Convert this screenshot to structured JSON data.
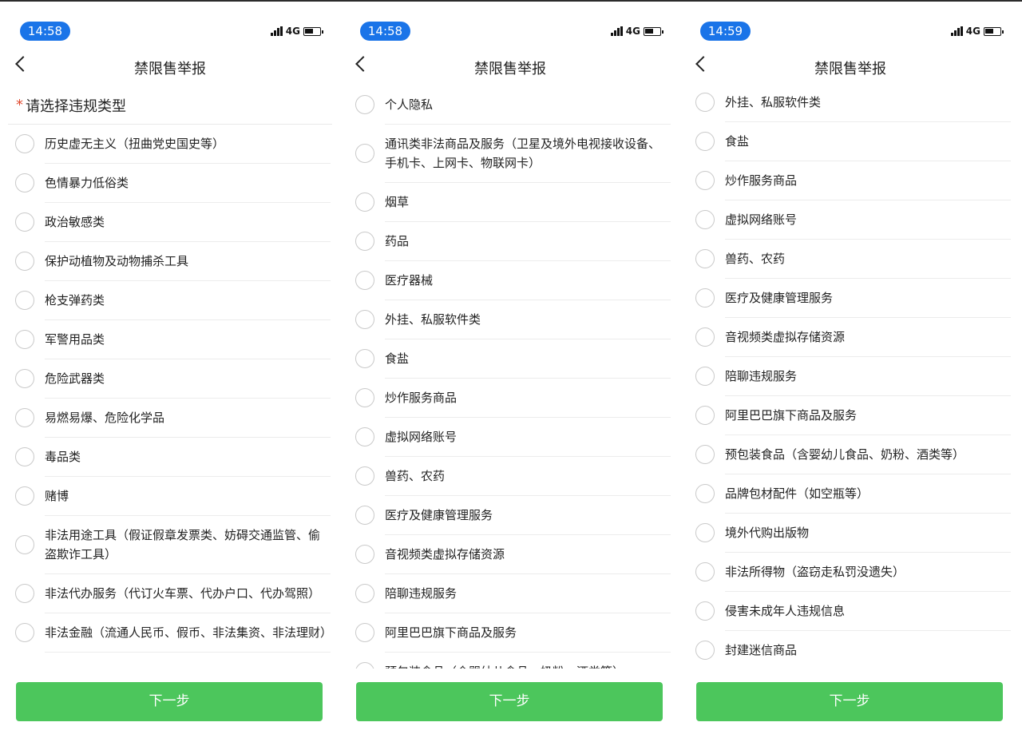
{
  "screens": [
    {
      "time": "14:58",
      "network": "4G",
      "title": "禁限售举报",
      "section_title": "请选择违规类型",
      "items": [
        "历史虚无主义（扭曲党史国史等）",
        "色情暴力低俗类",
        "政治敏感类",
        "保护动植物及动物捕杀工具",
        "枪支弹药类",
        "军警用品类",
        "危险武器类",
        "易燃易爆、危险化学品",
        "毒品类",
        "赌博",
        "非法用途工具（假证假章发票类、妨碍交通监管、偷盗欺诈工具）",
        "非法代办服务（代订火车票、代办户口、代办驾照）",
        "非法金融（流通人民币、假币、非法集资、非法理财）"
      ],
      "next_label": "下一步"
    },
    {
      "time": "14:58",
      "network": "4G",
      "title": "禁限售举报",
      "items": [
        "个人隐私",
        "通讯类非法商品及服务（卫星及境外电视接收设备、手机卡、上网卡、物联网卡）",
        "烟草",
        "药品",
        "医疗器械",
        "外挂、私服软件类",
        "食盐",
        "炒作服务商品",
        "虚拟网络账号",
        "兽药、农药",
        "医疗及健康管理服务",
        "音视频类虚拟存储资源",
        "陪聊违规服务",
        "阿里巴巴旗下商品及服务",
        "预包装食品（含婴幼儿食品、奶粉、酒类等）"
      ],
      "next_label": "下一步"
    },
    {
      "time": "14:59",
      "network": "4G",
      "title": "禁限售举报",
      "items": [
        "外挂、私服软件类",
        "食盐",
        "炒作服务商品",
        "虚拟网络账号",
        "兽药、农药",
        "医疗及健康管理服务",
        "音视频类虚拟存储资源",
        "陪聊违规服务",
        "阿里巴巴旗下商品及服务",
        "预包装食品（含婴幼儿食品、奶粉、酒类等）",
        "品牌包材配件（如空瓶等）",
        "境外代购出版物",
        "非法所得物（盗窃走私罚没遗失）",
        "侵害未成年人违规信息",
        "封建迷信商品"
      ],
      "next_label": "下一步"
    }
  ],
  "colors": {
    "accent_blue": "#1a74e8",
    "button_green": "#4cc65c",
    "required_star": "#e04a2f"
  }
}
